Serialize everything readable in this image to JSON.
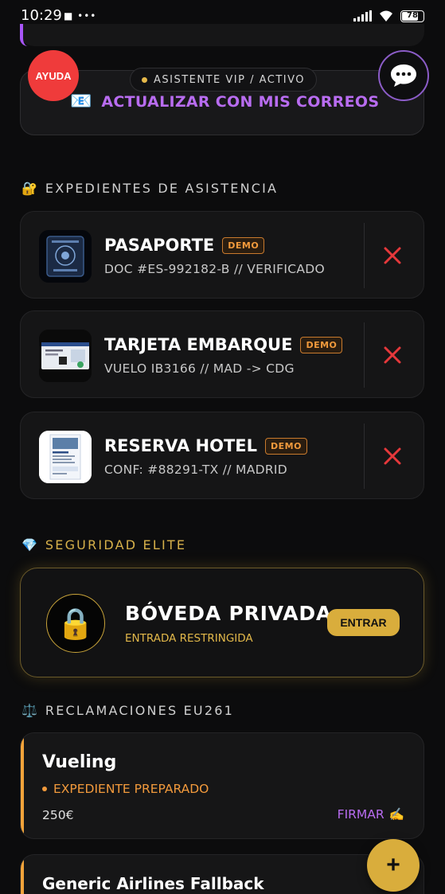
{
  "status_bar": {
    "time": "10:29",
    "left_icons": "■ •••",
    "battery": "78"
  },
  "help_button": {
    "label": "AYUDA",
    "color": "#ef3b3b"
  },
  "chat_button": {
    "icon": "chat-bubble-icon"
  },
  "email_card": {
    "badge": "ASISTENTE VIP / ACTIVO",
    "icon": "📧",
    "label": "ACTUALIZAR CON MIS CORREOS",
    "accent": "#b86cf0"
  },
  "sections": {
    "expedientes": {
      "emoji": "🔐",
      "title": "EXPEDIENTES DE ASISTENCIA",
      "color": "#cfcfcf"
    },
    "seguridad": {
      "emoji": "💎",
      "title": "SEGURIDAD ELITE",
      "color": "#d6b04a"
    },
    "reclamaciones": {
      "emoji": "⚖️",
      "title": "RECLAMACIONES EU261",
      "color": "#cfcfcf"
    }
  },
  "documents": [
    {
      "title": "PASAPORTE",
      "tag": "DEMO",
      "subtitle": "DOC #ES-992182-B // VERIFICADO",
      "thumb_icon": "passport-icon"
    },
    {
      "title": "TARJETA EMBARQUE",
      "tag": "DEMO",
      "subtitle": "VUELO IB3166 // MAD -> CDG",
      "thumb_icon": "boarding-pass-icon"
    },
    {
      "title": "RESERVA HOTEL",
      "tag": "DEMO",
      "subtitle": "CONF: #88291-TX // MADRID",
      "thumb_icon": "hotel-booking-icon"
    }
  ],
  "vault": {
    "icon": "🔒",
    "title": "BÓVEDA PRIVADA",
    "subtitle": "ENTRADA RESTRINGIDA",
    "button": "ENTRAR",
    "accent": "#d9ad3c"
  },
  "claims": [
    {
      "airline": "Vueling",
      "status": "EXPEDIENTE PREPARADO",
      "amount": "250€",
      "action": "FIRMAR",
      "action_icon": "✍️"
    },
    {
      "airline": "Generic Airlines Fallback"
    }
  ],
  "fab": {
    "label": "+"
  }
}
